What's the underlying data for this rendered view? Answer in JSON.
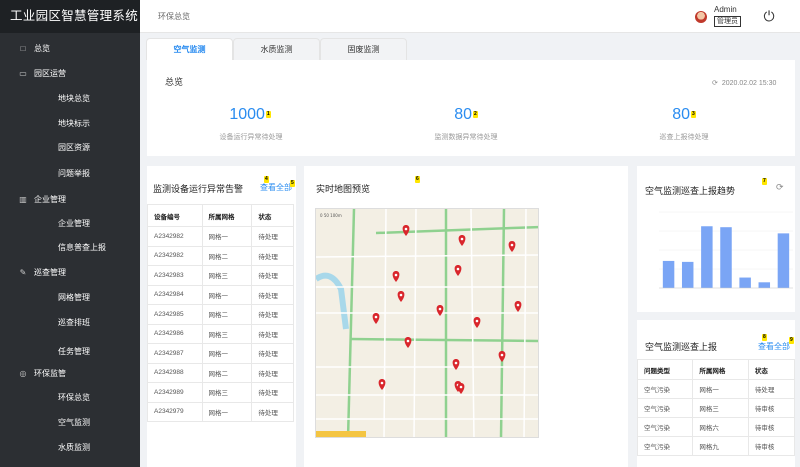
{
  "app": {
    "title": "工业园区智慧管理系统"
  },
  "sidebar": {
    "items": [
      {
        "label": "总览",
        "icon": "monitor-icon"
      },
      {
        "label": "园区运营",
        "icon": "display-icon"
      },
      {
        "label": "地块总览"
      },
      {
        "label": "地块标示"
      },
      {
        "label": "园区资源"
      },
      {
        "label": "问题举报"
      },
      {
        "label": "企业管理",
        "icon": "building-icon"
      },
      {
        "label": "企业管理"
      },
      {
        "label": "信息普查上报"
      },
      {
        "label": "巡查管理",
        "icon": "edit-icon"
      },
      {
        "label": "网格管理"
      },
      {
        "label": "巡查排班"
      },
      {
        "label": "任务管理"
      },
      {
        "label": "环保监管",
        "icon": "eco-icon"
      },
      {
        "label": "环保总览"
      },
      {
        "label": "空气监测"
      },
      {
        "label": "水质监测"
      }
    ]
  },
  "header": {
    "breadcrumb": "环保总览",
    "user_name": "Admin",
    "user_role": "管理员",
    "power_icon": "power-icon"
  },
  "tabs": [
    {
      "label": "空气监测",
      "active": true
    },
    {
      "label": "水质监测"
    },
    {
      "label": "固废监测"
    }
  ],
  "overview": {
    "title": "总览",
    "timestamp": "2020.02.02 15:30",
    "stats": [
      {
        "value": "1000",
        "label": "设备运行异常待处理",
        "badge": "1"
      },
      {
        "value": "80",
        "label": "监测数据异常待处理",
        "badge": "2"
      },
      {
        "value": "80",
        "label": "巡查上报待处理",
        "badge": "3"
      }
    ]
  },
  "alarms": {
    "title": "监测设备运行异常告警",
    "title_badge": "4",
    "view_all": "查看全部",
    "view_all_badge": "5",
    "columns": [
      "设备编号",
      "所属网格",
      "状态"
    ],
    "rows": [
      [
        "A2342982",
        "网格一",
        "待处理"
      ],
      [
        "A2342982",
        "网格二",
        "待处理"
      ],
      [
        "A2342983",
        "网格三",
        "待处理"
      ],
      [
        "A2342984",
        "网格一",
        "待处理"
      ],
      [
        "A2342985",
        "网格二",
        "待处理"
      ],
      [
        "A2342986",
        "网格三",
        "待处理"
      ],
      [
        "A2342987",
        "网格一",
        "待处理"
      ],
      [
        "A2342988",
        "网格二",
        "待处理"
      ],
      [
        "A2342989",
        "网格三",
        "待处理"
      ],
      [
        "A2342979",
        "网格一",
        "待处理"
      ]
    ]
  },
  "map": {
    "title": "实时地图预览",
    "badge": "6"
  },
  "trend": {
    "title": "空气监测巡查上报趋势",
    "badge": "7",
    "refresh_icon": "refresh-icon"
  },
  "chart_data": {
    "type": "bar",
    "values": [
      57,
      55,
      130,
      128,
      22,
      12,
      115
    ],
    "ylim": [
      0,
      160
    ],
    "grid": true
  },
  "reports": {
    "title": "空气监测巡查上报",
    "title_badge": "8",
    "view_all": "查看全部",
    "view_all_badge": "9",
    "columns": [
      "问题类型",
      "所属网格",
      "状态"
    ],
    "rows": [
      [
        "空气污染",
        "网格一",
        "待处理"
      ],
      [
        "空气污染",
        "网格三",
        "待审核"
      ],
      [
        "空气污染",
        "网格六",
        "待审核"
      ],
      [
        "空气污染",
        "网格九",
        "待审核"
      ]
    ]
  },
  "colors": {
    "accent": "#2a8cf0",
    "sidebar": "#2c2f33",
    "bar": "#7aa5f5",
    "badge": "#ffe600"
  }
}
